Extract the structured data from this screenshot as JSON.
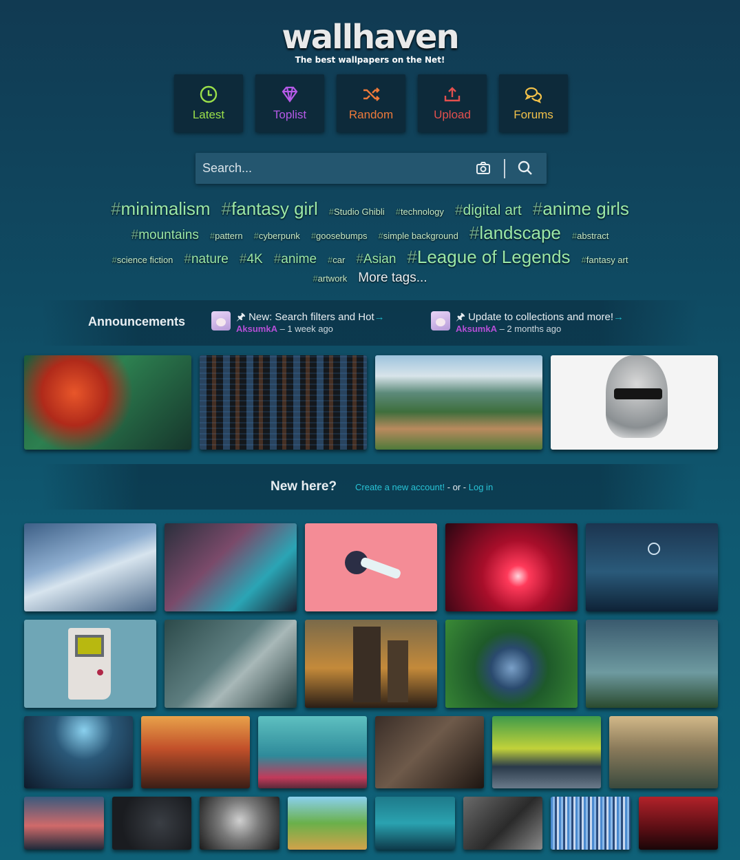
{
  "logo": {
    "wordmark": "wallhaven",
    "tagline": "The best wallpapers on the Net!"
  },
  "nav": [
    {
      "label": "Latest",
      "icon": "clock-icon",
      "color": "#9be04a"
    },
    {
      "label": "Toplist",
      "icon": "diamond-icon",
      "color": "#b65ae8"
    },
    {
      "label": "Random",
      "icon": "shuffle-icon",
      "color": "#ee7a3a"
    },
    {
      "label": "Upload",
      "icon": "upload-icon",
      "color": "#e2504e"
    },
    {
      "label": "Forums",
      "icon": "chat-bubbles-icon",
      "color": "#f2c14a"
    }
  ],
  "search": {
    "placeholder": "Search..."
  },
  "tags": {
    "row1": [
      {
        "label": "minimalism",
        "size": "xl"
      },
      {
        "label": "fantasy girl",
        "size": "xl"
      },
      {
        "label": "Studio Ghibli",
        "size": "s"
      },
      {
        "label": "technology",
        "size": "s"
      },
      {
        "label": "digital art",
        "size": "l"
      },
      {
        "label": "anime girls",
        "size": "xl"
      }
    ],
    "row2": [
      {
        "label": "mountains",
        "size": "m"
      },
      {
        "label": "pattern",
        "size": "s"
      },
      {
        "label": "cyberpunk",
        "size": "s"
      },
      {
        "label": "goosebumps",
        "size": "s"
      },
      {
        "label": "simple background",
        "size": "s"
      },
      {
        "label": "landscape",
        "size": "xl"
      },
      {
        "label": "abstract",
        "size": "s"
      }
    ],
    "row3": [
      {
        "label": "science fiction",
        "size": "s"
      },
      {
        "label": "nature",
        "size": "m"
      },
      {
        "label": "4K",
        "size": "m"
      },
      {
        "label": "anime",
        "size": "m"
      },
      {
        "label": "car",
        "size": "s"
      },
      {
        "label": "Asian",
        "size": "m"
      },
      {
        "label": "League of Legends",
        "size": "xl"
      },
      {
        "label": "fantasy art",
        "size": "s"
      }
    ],
    "row4": [
      {
        "label": "artwork",
        "size": "s"
      }
    ],
    "more_label": "More tags..."
  },
  "announcements": {
    "title": "Announcements",
    "items": [
      {
        "pin": "🖈",
        "text": "New: Search filters and Hot",
        "author": "AksumkA",
        "time": " – 1 week ago"
      },
      {
        "pin": "🖈",
        "text": "Update to collections and more!",
        "author": "AksumkA",
        "time": " – 2 months ago"
      }
    ]
  },
  "new_here": {
    "title": "New here?",
    "create_link": "Create a new account!",
    "separator": " - or - ",
    "login_link": "Log in"
  },
  "featured_thumbs": [
    "anime-girl-laptop",
    "code-screen",
    "terraced-valley",
    "white-hair-blindfold"
  ],
  "grid_row1": [
    "anime-girls-flying",
    "cyberpunk-girl",
    "swing-girl-pink",
    "red-city-sunset",
    "deer-moon-night"
  ],
  "grid_row2": [
    "gameboy",
    "mech-lab",
    "sunset-city-towers",
    "aerial-forest-lake",
    "stag-silhouette"
  ],
  "grid_row3": [
    "rocket-launch",
    "orange-mountains",
    "planet-ocean",
    "dark-room-girl",
    "yellow-muscle-car",
    "cliff-travelers"
  ],
  "grid_row4": [
    "sunset-road",
    "dark-abstract",
    "bw-portrait",
    "flower-town",
    "underwater-plane",
    "gothic-girl",
    "glitch-columns",
    "red-forest"
  ]
}
